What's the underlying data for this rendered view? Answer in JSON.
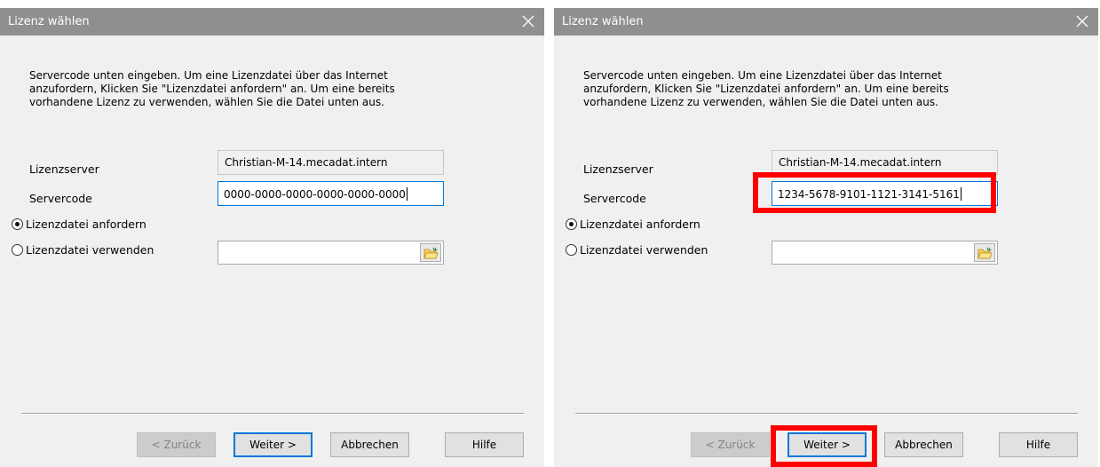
{
  "colors": {
    "title_bar": "#8f8f8f",
    "dialog_bg": "#f0f0f0",
    "focus_border": "#0078d7",
    "highlight": "#ff0000"
  },
  "icons": {
    "close": "close-icon",
    "folder": "folder-open-icon"
  },
  "dialogs": [
    {
      "title": "Lizenz wählen",
      "instructions": [
        "Servercode unten eingeben. Um eine Lizenzdatei über das Internet",
        "anzufordern, Klicken Sie \"Lizenzdatei anfordern\" an. Um eine bereits",
        "vorhandene Lizenz zu verwenden, wählen Sie die Datei unten aus."
      ],
      "license_server_label": "Lizenzserver",
      "license_server_value": "Christian-M-14.mecadat.intern",
      "server_code_label": "Servercode",
      "server_code_value": "0000-0000-0000-0000-0000-0000",
      "radio_request_label": "Lizenzdatei anfordern",
      "radio_use_label": "Lizenzdatei verwenden",
      "selected_option": "Lizenzdatei anfordern",
      "file_path_value": "",
      "buttons": {
        "back": "< Zurück",
        "next": "Weiter >",
        "cancel": "Abbrechen",
        "help": "Hilfe"
      }
    },
    {
      "title": "Lizenz wählen",
      "instructions": [
        "Servercode unten eingeben. Um eine Lizenzdatei über das Internet",
        "anzufordern, Klicken Sie \"Lizenzdatei anfordern\" an. Um eine bereits",
        "vorhandene Lizenz zu verwenden, wählen Sie die Datei unten aus."
      ],
      "license_server_label": "Lizenzserver",
      "license_server_value": "Christian-M-14.mecadat.intern",
      "server_code_label": "Servercode",
      "server_code_value": "1234-5678-9101-1121-3141-5161",
      "radio_request_label": "Lizenzdatei anfordern",
      "radio_use_label": "Lizenzdatei verwenden",
      "selected_option": "Lizenzdatei anfordern",
      "file_path_value": "",
      "buttons": {
        "back": "< Zurück",
        "next": "Weiter >",
        "cancel": "Abbrechen",
        "help": "Hilfe"
      }
    }
  ]
}
